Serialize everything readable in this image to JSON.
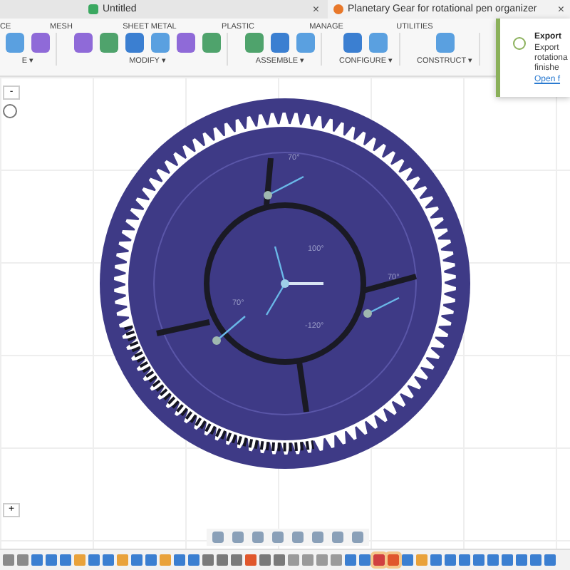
{
  "tabs": [
    {
      "label": "Untitled",
      "selected": false,
      "close": "×"
    },
    {
      "label": "Planetary Gear for rotational pen organizer",
      "selected": true,
      "close": "×"
    }
  ],
  "ribbon_tabs": [
    "CE",
    "MESH",
    "SHEET METAL",
    "PLASTIC",
    "MANAGE",
    "UTILITIES"
  ],
  "tool_groups": [
    {
      "label": "E ▾"
    },
    {
      "label": "MODIFY ▾"
    },
    {
      "label": "ASSEMBLE ▾"
    },
    {
      "label": "CONFIGURE ▾"
    },
    {
      "label": "CONSTRUCT ▾"
    }
  ],
  "notification": {
    "title": "Export",
    "lines": [
      "Export",
      "rotationa",
      "finishe"
    ],
    "link": "Open f"
  },
  "canvas": {
    "zoom_out": "-",
    "zoom_in": "+",
    "angle_labels": [
      "70°",
      "100°",
      "70°",
      "70°",
      "-120°"
    ]
  }
}
